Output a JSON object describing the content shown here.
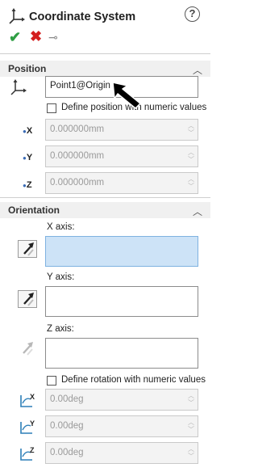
{
  "header": {
    "title": "Coordinate System",
    "help_label": "?"
  },
  "actions": {
    "ok_glyph": "✔",
    "cancel_glyph": "✖",
    "pin_glyph": "⊸"
  },
  "position": {
    "section_label": "Position",
    "origin_value": "Point1@Origin",
    "numeric_checkbox_label": "Define position with numeric values",
    "x_label": "X",
    "y_label": "Y",
    "z_label": "Z",
    "x_value": "0.000000mm",
    "y_value": "0.000000mm",
    "z_value": "0.000000mm"
  },
  "orientation": {
    "section_label": "Orientation",
    "x_axis_label": "X axis:",
    "y_axis_label": "Y axis:",
    "z_axis_label": "Z axis:",
    "x_axis_value": "",
    "y_axis_value": "",
    "z_axis_value": "",
    "numeric_checkbox_label": "Define rotation with numeric values",
    "rot_x_value": "0.00deg",
    "rot_y_value": "0.00deg",
    "rot_z_value": "0.00deg",
    "rot_x_label": "X",
    "rot_y_label": "Y",
    "rot_z_label": "Z"
  },
  "colors": {
    "accent_blue": "#cde3f7",
    "ok_green": "#2f9e44",
    "cancel_red": "#d31f1f"
  }
}
